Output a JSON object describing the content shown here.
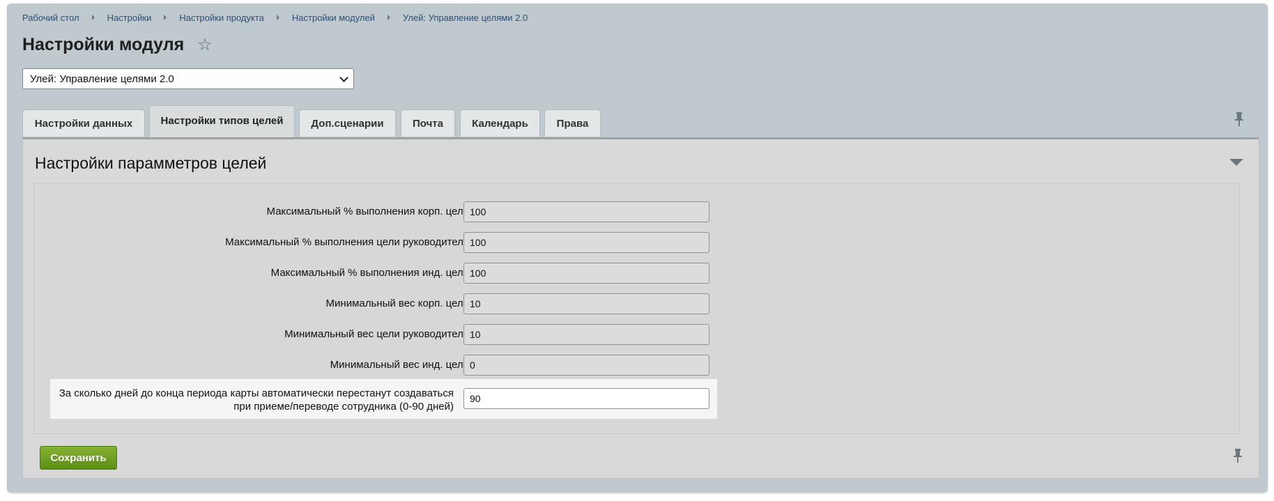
{
  "breadcrumb": [
    "Рабочий стол",
    "Настройки",
    "Настройки продукта",
    "Настройки модулей",
    "Улей: Управление целями 2.0"
  ],
  "page_title": "Настройки модуля",
  "module_select": {
    "value": "Улей: Управление целями 2.0"
  },
  "tabs": [
    {
      "label": "Настройки данных",
      "active": false
    },
    {
      "label": "Настройки типов целей",
      "active": true
    },
    {
      "label": "Доп.сценарии",
      "active": false
    },
    {
      "label": "Почта",
      "active": false
    },
    {
      "label": "Календарь",
      "active": false
    },
    {
      "label": "Права",
      "active": false
    }
  ],
  "section": {
    "title": "Настройки парамметров целей"
  },
  "fields": [
    {
      "label": "Максимальный % выполнения корп. цели",
      "value": "100"
    },
    {
      "label": "Максимальный % выполнения цели руководителя",
      "value": "100"
    },
    {
      "label": "Максимальный % выполнения инд. цели",
      "value": "100"
    },
    {
      "label": "Минимальный вес корп. цели",
      "value": "10"
    },
    {
      "label": "Минимальный вес цели руководителя",
      "value": "10"
    },
    {
      "label": "Минимальный вес инд. цели",
      "value": "0"
    }
  ],
  "highlight_field": {
    "label_line1": "За сколько дней до конца периода карты автоматически перестанут создаваться",
    "label_line2": "при приеме/переводе сотрудника (0-90 дней)",
    "value": "90"
  },
  "buttons": {
    "save_label": "Сохранить"
  },
  "colors": {
    "accent_green": "#6a9e1c",
    "frame_bg": "#c0c9cd",
    "link": "#2a4d7c"
  }
}
